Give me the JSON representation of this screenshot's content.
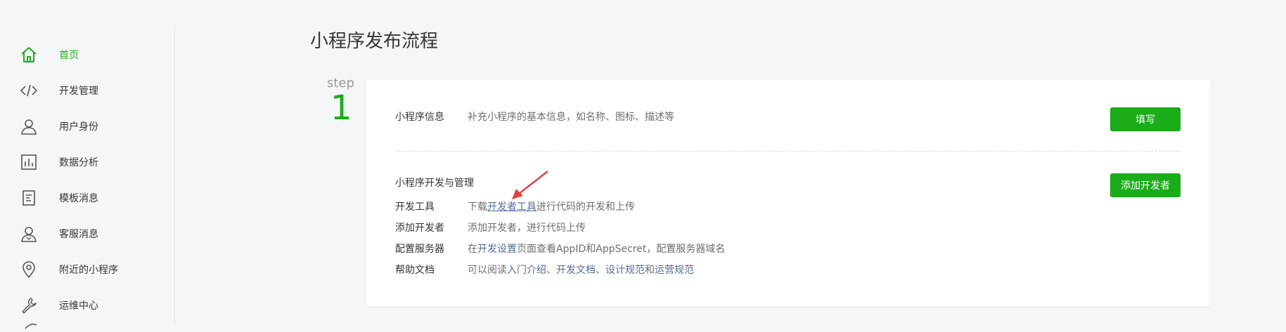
{
  "sidebar": {
    "items": [
      {
        "label": "首页",
        "icon": "home-icon",
        "active": true
      },
      {
        "label": "开发管理",
        "icon": "code-icon"
      },
      {
        "label": "用户身份",
        "icon": "user-icon"
      },
      {
        "label": "数据分析",
        "icon": "chart-icon"
      },
      {
        "label": "模板消息",
        "icon": "document-icon"
      },
      {
        "label": "客服消息",
        "icon": "customer-service-icon"
      },
      {
        "label": "附近的小程序",
        "icon": "location-pin-icon"
      },
      {
        "label": "运维中心",
        "icon": "wrench-icon"
      }
    ]
  },
  "main": {
    "title": "小程序发布流程",
    "step_word": "step",
    "step_number": "1",
    "info": {
      "label": "小程序信息",
      "desc": "补充小程序的基本信息，如名称、图标、描述等",
      "button": "填写"
    },
    "dev": {
      "heading": "小程序开发与管理",
      "button": "添加开发者",
      "tools_label": "开发工具",
      "tools_pre": "下载",
      "tools_link": "开发者工具",
      "tools_post": "进行代码的开发和上传",
      "adddev_label": "添加开发者",
      "adddev_desc": "添加开发者，进行代码上传",
      "server_label": "配置服务器",
      "server_pre": "在",
      "server_link": "开发设置",
      "server_post": "页面查看AppID和AppSecret，配置服务器域名",
      "help_label": "帮助文档",
      "help_pre": "可以阅读",
      "help_link1": "入门介绍",
      "help_sep1": "、",
      "help_link2": "开发文档",
      "help_sep2": "、",
      "help_link3": "设计规范",
      "help_and": "和",
      "help_link4": "运营规范"
    }
  },
  "colors": {
    "accent": "#1aad19",
    "link": "#576b95",
    "arrow": "#e64340"
  }
}
